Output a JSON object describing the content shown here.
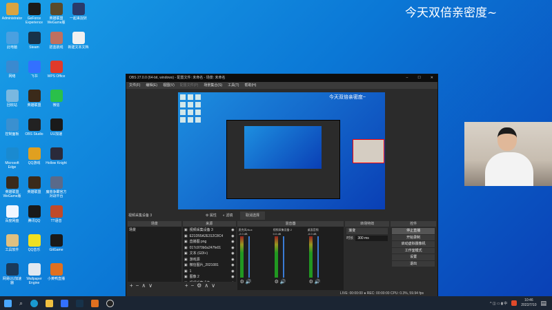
{
  "banner": "今天双倍亲密度~",
  "desktop_icons": [
    {
      "label": "Administrator",
      "color": "#d9a441"
    },
    {
      "label": "GeForce Experience",
      "color": "#1b1b1b"
    },
    {
      "label": "英雄联盟WeGame版",
      "color": "#5a4a2a"
    },
    {
      "label": "一起来捉妖",
      "color": "#2a3a6a"
    },
    {
      "label": "此电脑",
      "color": "#4aa0e0"
    },
    {
      "label": "Steam",
      "color": "#17324a"
    },
    {
      "label": "碧蓝航线",
      "color": "#c07060"
    },
    {
      "label": "新建文本文档",
      "color": "#f0f0f0"
    },
    {
      "label": "网络",
      "color": "#3a8ad0"
    },
    {
      "label": "飞书",
      "color": "#3370ff"
    },
    {
      "label": "WPS Office",
      "color": "#e03a2a"
    },
    {
      "label": "",
      "color": ""
    },
    {
      "label": "回收站",
      "color": "#7ab8e0"
    },
    {
      "label": "英雄联盟",
      "color": "#3a2a1a"
    },
    {
      "label": "微信",
      "color": "#2ac04a"
    },
    {
      "label": "",
      "color": ""
    },
    {
      "label": "控制面板",
      "color": "#3a90d0"
    },
    {
      "label": "OBS Studio",
      "color": "#222"
    },
    {
      "label": "UU加速",
      "color": "#1a1a1a"
    },
    {
      "label": "",
      "color": ""
    },
    {
      "label": "Microsoft Edge",
      "color": "#1a8ad0"
    },
    {
      "label": "QQ游戏",
      "color": "#e0a020"
    },
    {
      "label": "Hollow Knight",
      "color": "#2a2a3a"
    },
    {
      "label": "",
      "color": ""
    },
    {
      "label": "英雄联盟WeGame版",
      "color": "#3a2a1a"
    },
    {
      "label": "英雄联盟",
      "color": "#3a2a1a"
    },
    {
      "label": "魔兽争霸官方对战平台",
      "color": "#5a6a8a"
    },
    {
      "label": "",
      "color": ""
    },
    {
      "label": "百度网盘",
      "color": "#f0f6ff"
    },
    {
      "label": "腾讯QQ",
      "color": "#1a1a1a"
    },
    {
      "label": "TT语音",
      "color": "#c04a2a"
    },
    {
      "label": "",
      "color": ""
    },
    {
      "label": "工具软件",
      "color": "#e0c080"
    },
    {
      "label": "QQ音乐",
      "color": "#f0e020"
    },
    {
      "label": "GitGame",
      "color": "#1a1a1a"
    },
    {
      "label": "",
      "color": ""
    },
    {
      "label": "网易UU加速器",
      "color": "#1a3a5a"
    },
    {
      "label": "Wallpaper Engine",
      "color": "#e0e8f0"
    },
    {
      "label": "小黄鸭直播",
      "color": "#e07020"
    },
    {
      "label": "",
      "color": ""
    }
  ],
  "obs": {
    "title": "OBS 27.0.0 (64-bit, windows) - 配置文件: 未命名 - 场景: 未命名",
    "window_controls": [
      "–",
      "☐",
      "✕"
    ],
    "menu": [
      "文件(F)",
      "编辑(E)",
      "视图(V)",
      "配置文件(P)",
      "场景集合(S)",
      "工具(T)",
      "帮助(H)"
    ],
    "preview_text": "今天双倍亲密度~",
    "source_name": "视频采集设备 3",
    "properties": "⚙ 属性",
    "filters": "◐ 滤镜",
    "deselect": "取消选择",
    "docks": {
      "scenes": "场景",
      "sources": "来源",
      "mixer": "混音器",
      "transitions": "转场特效",
      "controls": "控件"
    },
    "scenes": [
      "场景"
    ],
    "sources": [
      "视频采集设备 3",
      "E21D55A2E312C8C4",
      "直播图 png",
      "017c970b0a247fe01",
      "文本 (GDI+)",
      "游戏源",
      "微信图片_2021081",
      "1",
      "图像 2",
      "视频采集设备"
    ],
    "mixer": [
      {
        "name": "麦克风/Aux",
        "db": "-2.0 dB"
      },
      {
        "name": "视频采集设备 2",
        "db": "0.0 dB"
      },
      {
        "name": "桌面音频",
        "db": "-0.0 dB"
      }
    ],
    "transition": "渐变",
    "duration_label": "时长",
    "duration": "300 ms",
    "controls": [
      "停止直播",
      "开始录制",
      "启动虚拟摄像机",
      "工作室模式",
      "设置",
      "退出"
    ],
    "status": "LIVE: 00:00:00   ● REC: 00:00:00   CPU: 0.3%, 59.94 fps"
  },
  "taskbar": {
    "time": "10:46",
    "date": "2022/7/10",
    "tray": "^ ◫ ▭ ▮ 中"
  }
}
